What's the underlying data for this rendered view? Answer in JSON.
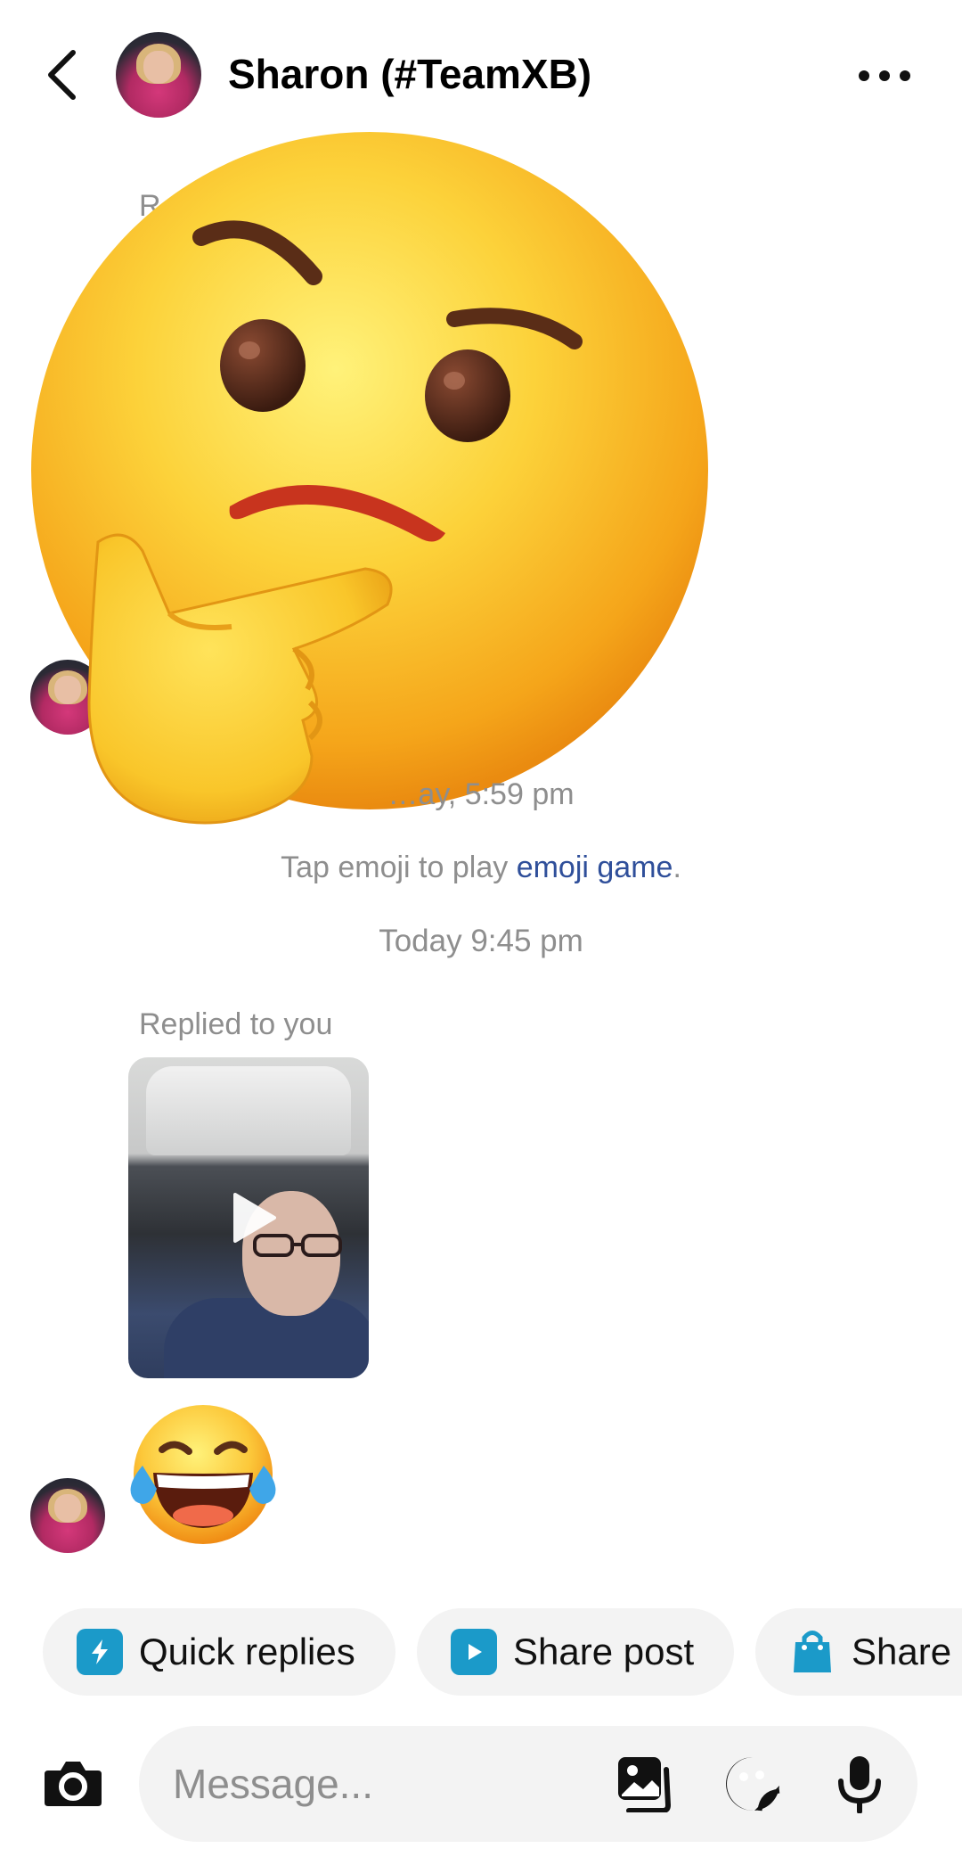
{
  "header": {
    "title": "Sharon (#TeamXB)",
    "back_icon": "chevron-left-icon",
    "more_icon": "more-horizontal-icon"
  },
  "thread": {
    "partial_label": "R",
    "timestamp_1": "…ay, 5:59 pm",
    "hint_prefix": "Tap emoji to play ",
    "hint_link": "emoji game",
    "hint_suffix": ".",
    "timestamp_2": "Today 9:45 pm",
    "replied_label": "Replied to you",
    "big_emoji": "thinking-face",
    "reaction_emoji": "face-with-tears-of-joy"
  },
  "quick_actions": [
    {
      "label": "Quick replies",
      "icon": "quick-reply-icon"
    },
    {
      "label": "Share post",
      "icon": "share-post-icon"
    },
    {
      "label": "Share",
      "icon": "shopping-bag-icon"
    }
  ],
  "composer": {
    "placeholder": "Message..."
  },
  "colors": {
    "link": "#2f4f9a",
    "chip_icon": "#1b9ac9",
    "muted_text": "#8e8e8e"
  }
}
